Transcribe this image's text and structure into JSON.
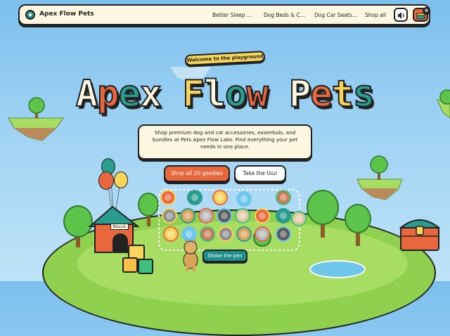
{
  "nav": {
    "brand": "Apex Flow Pets",
    "links": [
      "Better Sleep ...",
      "Dog Beds & C...",
      "Dog Car Seats...",
      "Shop all"
    ],
    "cart_count": "0"
  },
  "hero": {
    "pill": "Welcome to the playground",
    "title_letters": [
      {
        "ch": "A",
        "color": "#fdf7e2"
      },
      {
        "ch": "p",
        "color": "#e9673d"
      },
      {
        "ch": "e",
        "color": "#2a9d8f"
      },
      {
        "ch": "x",
        "color": "#fdf7e2"
      },
      {
        "ch": " ",
        "color": "#fdf7e2"
      },
      {
        "ch": "F",
        "color": "#f7d55a"
      },
      {
        "ch": "l",
        "color": "#fdf7e2"
      },
      {
        "ch": "o",
        "color": "#2a9d8f"
      },
      {
        "ch": "w",
        "color": "#e9673d"
      },
      {
        "ch": " ",
        "color": "#fdf7e2"
      },
      {
        "ch": "P",
        "color": "#fdf7e2"
      },
      {
        "ch": "e",
        "color": "#e9673d"
      },
      {
        "ch": "t",
        "color": "#f7d55a"
      },
      {
        "ch": "s",
        "color": "#2a9d8f"
      }
    ],
    "description": "Shop premium dog and cat accessories, essentials, and bundles at Pets Apex Flow Labs. Find everything your pet needs in one place.",
    "primary_cta": "Shop all 20 goodies",
    "secondary_cta": "Take the tour"
  },
  "scene": {
    "house_sign": "Biscuit",
    "shake_button": "Shake the pen"
  },
  "colors": {
    "accent": "#e9673d",
    "teal": "#2a9d8f",
    "yellow": "#f7d55a",
    "cream": "#fdf7e2"
  },
  "icons": {
    "logo": "paw-logo-icon",
    "sound": "speaker-icon",
    "cart": "treasure-chest-cart-icon"
  }
}
